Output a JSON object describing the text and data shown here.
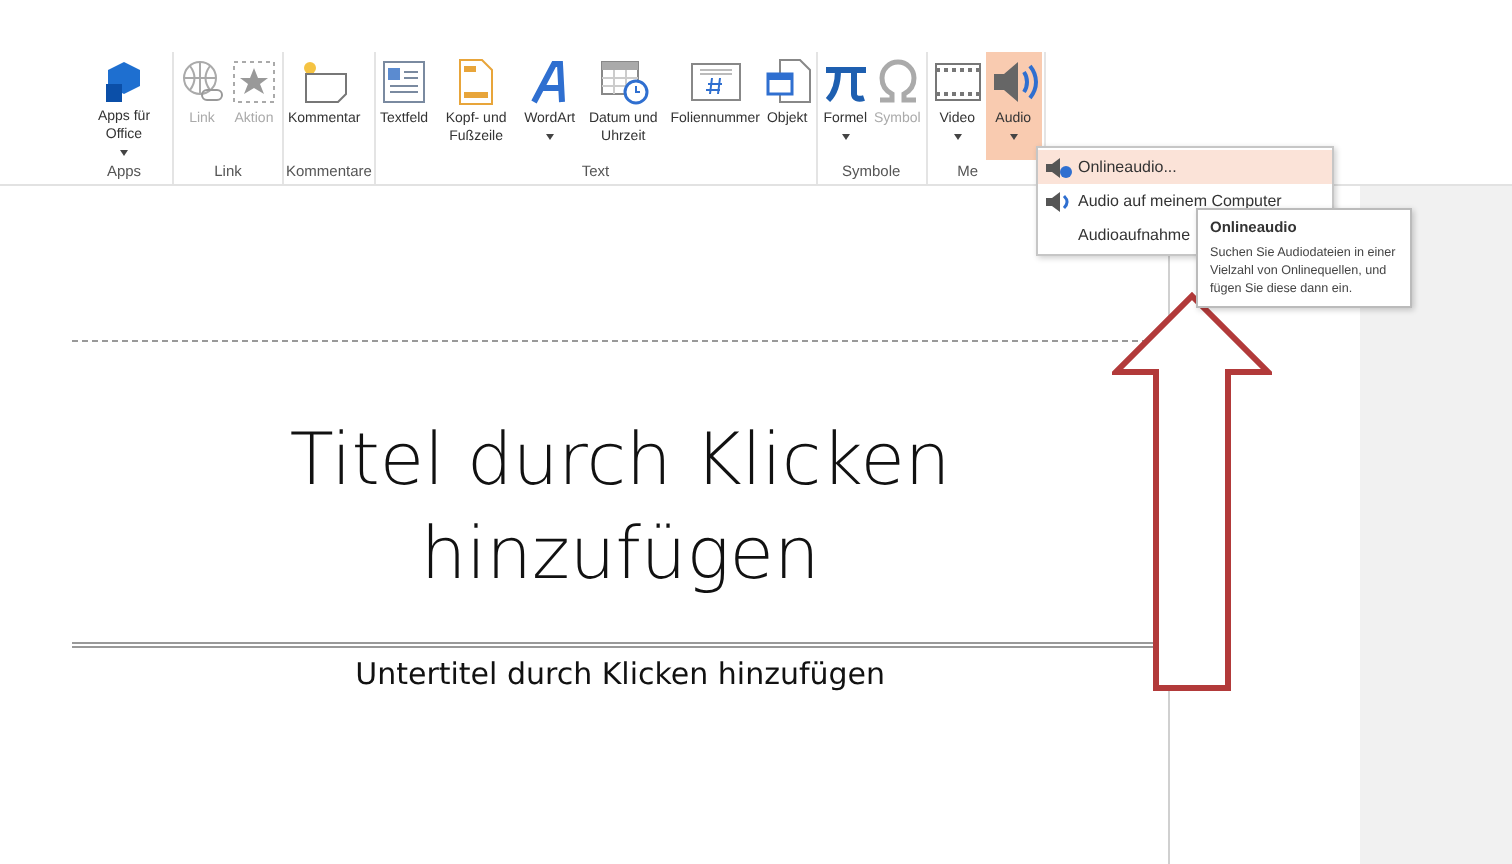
{
  "ribbon": {
    "groups": [
      {
        "label": "Apps",
        "buttons": [
          {
            "label": "Apps für Office",
            "dropdown": true,
            "disabled": false,
            "selected": false
          }
        ]
      },
      {
        "label": "Link",
        "buttons": [
          {
            "label": "Link",
            "dropdown": false,
            "disabled": true,
            "selected": false
          },
          {
            "label": "Aktion",
            "dropdown": false,
            "disabled": true,
            "selected": false
          }
        ]
      },
      {
        "label": "Kommentare",
        "buttons": [
          {
            "label": "Kommentar",
            "dropdown": false,
            "disabled": false,
            "selected": false
          }
        ]
      },
      {
        "label": "Text",
        "buttons": [
          {
            "label": "Textfeld",
            "dropdown": false,
            "disabled": false,
            "selected": false
          },
          {
            "label": "Kopf- und Fußzeile",
            "dropdown": false,
            "disabled": false,
            "selected": false
          },
          {
            "label": "WordArt",
            "dropdown": true,
            "disabled": false,
            "selected": false
          },
          {
            "label": "Datum und Uhrzeit",
            "dropdown": false,
            "disabled": false,
            "selected": false
          },
          {
            "label": "Foliennummer",
            "dropdown": false,
            "disabled": false,
            "selected": false
          },
          {
            "label": "Objekt",
            "dropdown": false,
            "disabled": false,
            "selected": false
          }
        ]
      },
      {
        "label": "Symbole",
        "buttons": [
          {
            "label": "Formel",
            "dropdown": true,
            "disabled": false,
            "selected": false
          },
          {
            "label": "Symbol",
            "dropdown": false,
            "disabled": true,
            "selected": false
          }
        ]
      },
      {
        "label": "Me",
        "buttons": [
          {
            "label": "Video",
            "dropdown": true,
            "disabled": false,
            "selected": false
          },
          {
            "label": "Audio",
            "dropdown": true,
            "disabled": false,
            "selected": true
          }
        ]
      }
    ]
  },
  "menu": {
    "items": [
      {
        "label": "Onlineaudio...",
        "selected": true
      },
      {
        "label": "Audio auf meinem Computer",
        "selected": false
      },
      {
        "label": "Audioaufnahme",
        "selected": false
      }
    ]
  },
  "tooltip": {
    "title": "Onlineaudio",
    "text": "Suchen Sie Audiodateien in einer Vielzahl von Onlinequellen, und fügen Sie diese dann ein."
  },
  "slide": {
    "title": "Titel durch Klicken hinzufügen",
    "subtitle": "Untertitel durch Klicken hinzufügen"
  }
}
